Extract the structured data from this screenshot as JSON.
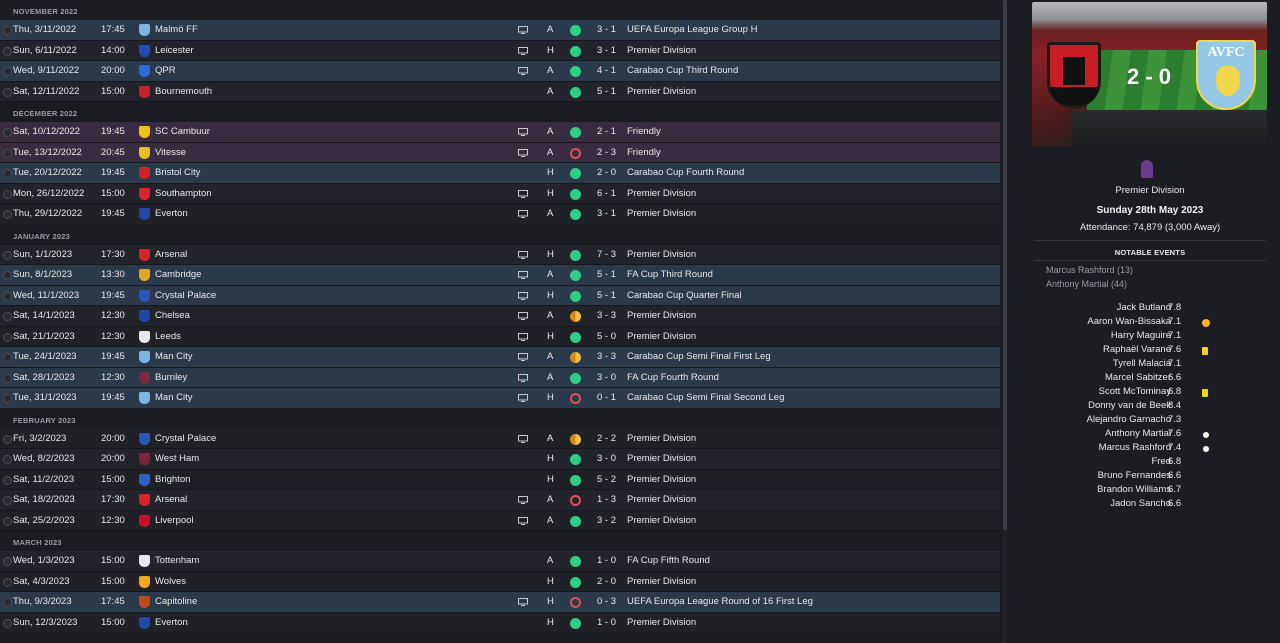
{
  "colors": {
    "win": "#2fce86",
    "loss": "#e0505a",
    "draw": "#d38a1a",
    "highlight_row": "#2a3a4a",
    "friendly_row": "#3a2c40"
  },
  "months": [
    {
      "label": "NOVEMBER 2022",
      "rows": [
        {
          "date": "Thu, 3/11/2022",
          "time": "17:45",
          "opp": "Malmö FF",
          "crest": "#7fb4e0",
          "tv": true,
          "ha": "A",
          "res": "w",
          "score": "3 - 1",
          "comp": "UEFA Europa League Group H",
          "style": "hl"
        },
        {
          "date": "Sun, 6/11/2022",
          "time": "14:00",
          "opp": "Leicester",
          "crest": "#1f4fb0",
          "tv": true,
          "ha": "H",
          "res": "w",
          "score": "3 - 1",
          "comp": "Premier Division",
          "style": "even"
        },
        {
          "date": "Wed, 9/11/2022",
          "time": "20:00",
          "opp": "QPR",
          "crest": "#2d6bd6",
          "tv": true,
          "ha": "A",
          "res": "w",
          "score": "4 - 1",
          "comp": "Carabao Cup Third Round",
          "style": "hl"
        },
        {
          "date": "Sat, 12/11/2022",
          "time": "15:00",
          "opp": "Bournemouth",
          "crest": "#c0252b",
          "tv": false,
          "ha": "A",
          "res": "w",
          "score": "5 - 1",
          "comp": "Premier Division",
          "style": "even"
        }
      ]
    },
    {
      "label": "DECEMBER 2022",
      "rows": [
        {
          "date": "Sat, 10/12/2022",
          "time": "19:45",
          "opp": "SC Cambuur",
          "crest": "#f0c21a",
          "tv": true,
          "ha": "A",
          "res": "w",
          "score": "2 - 1",
          "comp": "Friendly",
          "style": "fr"
        },
        {
          "date": "Tue, 13/12/2022",
          "time": "20:45",
          "opp": "Vitesse",
          "crest": "#e8c020",
          "tv": true,
          "ha": "A",
          "res": "l",
          "score": "2 - 3",
          "comp": "Friendly",
          "style": "fr"
        },
        {
          "date": "Tue, 20/12/2022",
          "time": "19:45",
          "opp": "Bristol City",
          "crest": "#d1222a",
          "tv": false,
          "ha": "H",
          "res": "w",
          "score": "2 - 0",
          "comp": "Carabao Cup Fourth Round",
          "style": "hl"
        },
        {
          "date": "Mon, 26/12/2022",
          "time": "15:00",
          "opp": "Southampton",
          "crest": "#d8262e",
          "tv": true,
          "ha": "H",
          "res": "w",
          "score": "6 - 1",
          "comp": "Premier Division",
          "style": "even"
        },
        {
          "date": "Thu, 29/12/2022",
          "time": "19:45",
          "opp": "Everton",
          "crest": "#2646a8",
          "tv": true,
          "ha": "A",
          "res": "w",
          "score": "3 - 1",
          "comp": "Premier Division",
          "style": "odd"
        }
      ]
    },
    {
      "label": "JANUARY 2023",
      "rows": [
        {
          "date": "Sun, 1/1/2023",
          "time": "17:30",
          "opp": "Arsenal",
          "crest": "#d8232a",
          "tv": true,
          "ha": "H",
          "res": "w",
          "score": "7 - 3",
          "comp": "Premier Division",
          "style": "even"
        },
        {
          "date": "Sun, 8/1/2023",
          "time": "13:30",
          "opp": "Cambridge",
          "crest": "#e0a82a",
          "tv": true,
          "ha": "A",
          "res": "w",
          "score": "5 - 1",
          "comp": "FA Cup Third Round",
          "style": "hl"
        },
        {
          "date": "Wed, 11/1/2023",
          "time": "19:45",
          "opp": "Crystal Palace",
          "crest": "#2b56b5",
          "tv": true,
          "ha": "H",
          "res": "w",
          "score": "5 - 1",
          "comp": "Carabao Cup Quarter Final",
          "style": "hl"
        },
        {
          "date": "Sat, 14/1/2023",
          "time": "12:30",
          "opp": "Chelsea",
          "crest": "#1a47a8",
          "tv": true,
          "ha": "A",
          "res": "d",
          "score": "3 - 3",
          "comp": "Premier Division",
          "style": "even"
        },
        {
          "date": "Sat, 21/1/2023",
          "time": "12:30",
          "opp": "Leeds",
          "crest": "#e8e8ea",
          "tv": true,
          "ha": "H",
          "res": "w",
          "score": "5 - 0",
          "comp": "Premier Division",
          "style": "odd"
        },
        {
          "date": "Tue, 24/1/2023",
          "time": "19:45",
          "opp": "Man City",
          "crest": "#7cb7e4",
          "tv": true,
          "ha": "A",
          "res": "d",
          "score": "3 - 3",
          "comp": "Carabao Cup Semi Final First Leg",
          "style": "hl"
        },
        {
          "date": "Sat, 28/1/2023",
          "time": "12:30",
          "opp": "Burnley",
          "crest": "#7a2a44",
          "tv": true,
          "ha": "A",
          "res": "w",
          "score": "3 - 0",
          "comp": "FA Cup Fourth Round",
          "style": "hl"
        },
        {
          "date": "Tue, 31/1/2023",
          "time": "19:45",
          "opp": "Man City",
          "crest": "#7cb7e4",
          "tv": true,
          "ha": "H",
          "res": "l",
          "score": "0 - 1",
          "comp": "Carabao Cup Semi Final Second Leg",
          "style": "hl"
        }
      ]
    },
    {
      "label": "FEBRUARY 2023",
      "rows": [
        {
          "date": "Fri, 3/2/2023",
          "time": "20:00",
          "opp": "Crystal Palace",
          "crest": "#2b56b5",
          "tv": true,
          "ha": "A",
          "res": "d",
          "score": "2 - 2",
          "comp": "Premier Division",
          "style": "odd"
        },
        {
          "date": "Wed, 8/2/2023",
          "time": "20:00",
          "opp": "West Ham",
          "crest": "#7a2638",
          "tv": false,
          "ha": "H",
          "res": "w",
          "score": "3 - 0",
          "comp": "Premier Division",
          "style": "even"
        },
        {
          "date": "Sat, 11/2/2023",
          "time": "15:00",
          "opp": "Brighton",
          "crest": "#2b62c4",
          "tv": false,
          "ha": "H",
          "res": "w",
          "score": "5 - 2",
          "comp": "Premier Division",
          "style": "odd"
        },
        {
          "date": "Sat, 18/2/2023",
          "time": "17:30",
          "opp": "Arsenal",
          "crest": "#d8232a",
          "tv": true,
          "ha": "A",
          "res": "l",
          "score": "1 - 3",
          "comp": "Premier Division",
          "style": "even"
        },
        {
          "date": "Sat, 25/2/2023",
          "time": "12:30",
          "opp": "Liverpool",
          "crest": "#c8102e",
          "tv": true,
          "ha": "A",
          "res": "w",
          "score": "3 - 2",
          "comp": "Premier Division",
          "style": "odd"
        }
      ]
    },
    {
      "label": "MARCH 2023",
      "rows": [
        {
          "date": "Wed, 1/3/2023",
          "time": "15:00",
          "opp": "Tottenham",
          "crest": "#e8e8ee",
          "tv": false,
          "ha": "A",
          "res": "w",
          "score": "1 - 0",
          "comp": "FA Cup Fifth Round",
          "style": "even"
        },
        {
          "date": "Sat, 4/3/2023",
          "time": "15:00",
          "opp": "Wolves",
          "crest": "#f2a81c",
          "tv": false,
          "ha": "H",
          "res": "w",
          "score": "2 - 0",
          "comp": "Premier Division",
          "style": "odd"
        },
        {
          "date": "Thu, 9/3/2023",
          "time": "17:45",
          "opp": "Capitoline",
          "crest": "#c04a1a",
          "tv": true,
          "ha": "H",
          "res": "l",
          "score": "0 - 3",
          "comp": "UEFA Europa League Round of 16 First Leg",
          "style": "hl"
        },
        {
          "date": "Sun, 12/3/2023",
          "time": "15:00",
          "opp": "Everton",
          "crest": "#2646a8",
          "tv": false,
          "ha": "H",
          "res": "w",
          "score": "1 - 0",
          "comp": "Premier Division",
          "style": "odd"
        }
      ]
    }
  ],
  "match": {
    "score": "2 - 0",
    "away_abbr": "AVFC",
    "competition": "Premier Division",
    "date": "Sunday 28th May 2023",
    "attendance": "Attendance: 74,879 (3,000 Away)",
    "notable_title": "NOTABLE EVENTS",
    "scorers": [
      "Marcus Rashford (13)",
      "Anthony Martial (44)"
    ]
  },
  "ratings": [
    {
      "name": "Jack Butland",
      "rating": "7.8",
      "event": ""
    },
    {
      "name": "Aaron Wan-Bissaka",
      "rating": "7.1",
      "event": "assist"
    },
    {
      "name": "Harry Maguire",
      "rating": "7.1",
      "event": ""
    },
    {
      "name": "Raphaël Varane",
      "rating": "7.6",
      "event": "card"
    },
    {
      "name": "Tyrell Malacia",
      "rating": "7.1",
      "event": ""
    },
    {
      "name": "Marcel Sabitzer",
      "rating": "6.6",
      "event": ""
    },
    {
      "name": "Scott McTominay",
      "rating": "6.8",
      "event": "card"
    },
    {
      "name": "Donny van de Beek",
      "rating": "8.4",
      "event": ""
    },
    {
      "name": "Alejandro Garnacho",
      "rating": "7.3",
      "event": ""
    },
    {
      "name": "Anthony Martial",
      "rating": "7.6",
      "event": "ball"
    },
    {
      "name": "Marcus Rashford",
      "rating": "7.4",
      "event": "ball"
    },
    {
      "name": "Fred",
      "rating": "6.8",
      "event": ""
    },
    {
      "name": "Bruno Fernandes",
      "rating": "6.6",
      "event": ""
    },
    {
      "name": "Brandon Williams",
      "rating": "6.7",
      "event": ""
    },
    {
      "name": "Jadon Sancho",
      "rating": "6.6",
      "event": ""
    }
  ]
}
